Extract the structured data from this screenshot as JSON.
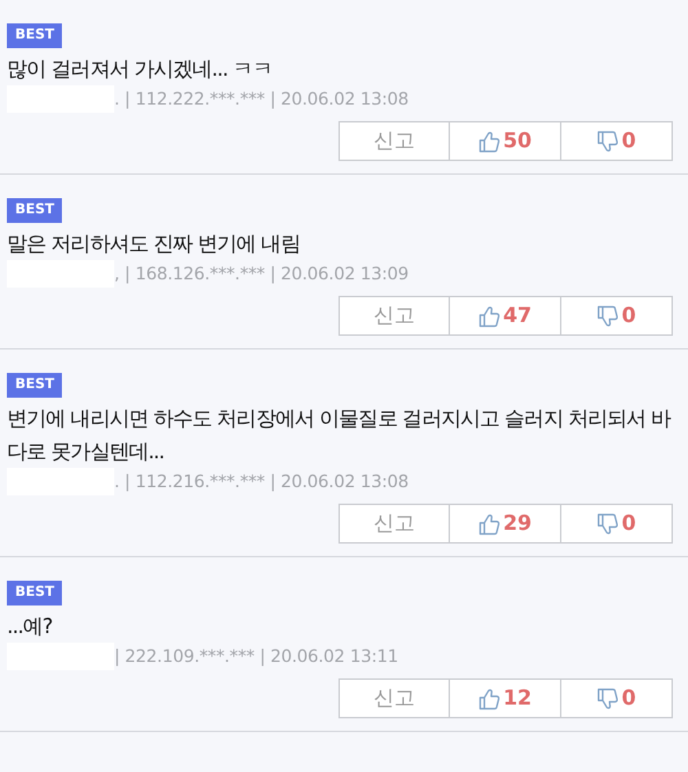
{
  "comments": [
    {
      "badge": "BEST",
      "text": "많이 걸러져서 가시겠네... ㅋㅋ",
      "meta": ". | 112.222.***.*** | 20.06.02 13:08",
      "report": "신고",
      "likes": "50",
      "dislikes": "0"
    },
    {
      "badge": "BEST",
      "text": "말은 저리하셔도 진짜 변기에 내림",
      "meta": ", | 168.126.***.*** | 20.06.02 13:09",
      "report": "신고",
      "likes": "47",
      "dislikes": "0"
    },
    {
      "badge": "BEST",
      "text": "변기에 내리시면 하수도 처리장에서 이물질로 걸러지시고 슬러지 처리되서 바다로 못가실텐데...",
      "meta": ". | 112.216.***.*** | 20.06.02 13:08",
      "report": "신고",
      "likes": "29",
      "dislikes": "0"
    },
    {
      "badge": "BEST",
      "text": "...예?",
      "meta": "| 222.109.***.*** | 20.06.02 13:11",
      "report": "신고",
      "likes": "12",
      "dislikes": "0"
    }
  ]
}
